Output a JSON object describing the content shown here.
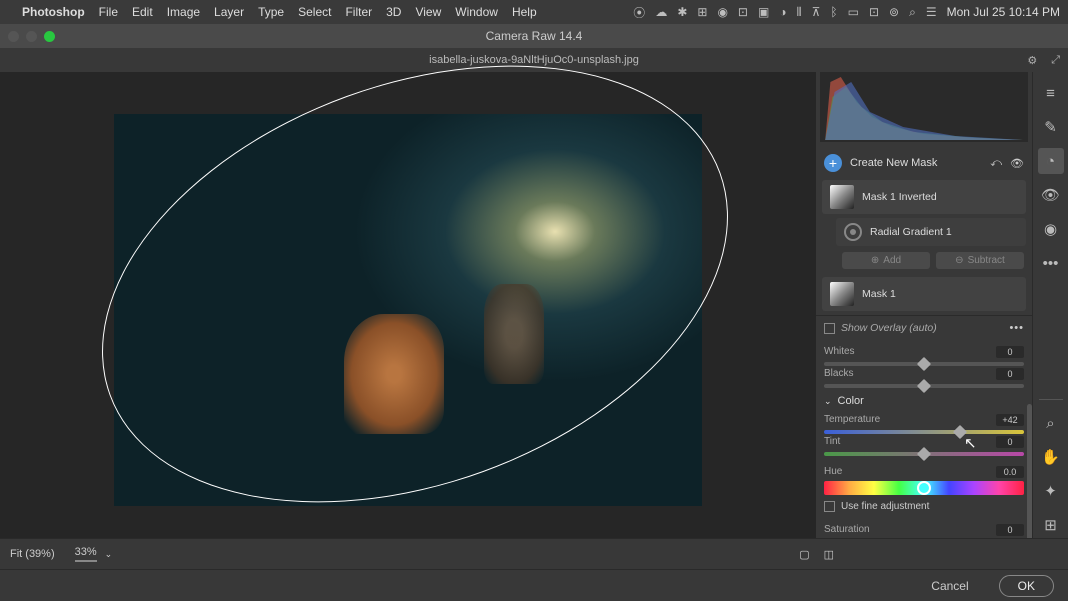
{
  "menubar": {
    "app": "Photoshop",
    "items": [
      "File",
      "Edit",
      "Image",
      "Layer",
      "Type",
      "Select",
      "Filter",
      "3D",
      "View",
      "Window",
      "Help"
    ],
    "datetime": "Mon Jul 25  10:14 PM"
  },
  "window": {
    "title": "Camera Raw 14.4",
    "filename": "isabella-juskova-9aNltHjuOc0-unsplash.jpg"
  },
  "masking": {
    "create_label": "Create New Mask",
    "mask1_inverted": "Mask 1 Inverted",
    "radial_gradient": "Radial Gradient 1",
    "add": "Add",
    "subtract": "Subtract",
    "mask1": "Mask 1",
    "overlay_label": "Show Overlay (auto)"
  },
  "adjustments": {
    "whites": {
      "label": "Whites",
      "value": "0"
    },
    "blacks": {
      "label": "Blacks",
      "value": "0"
    },
    "color_section": "Color",
    "temperature": {
      "label": "Temperature",
      "value": "+42"
    },
    "tint": {
      "label": "Tint",
      "value": "0"
    },
    "hue": {
      "label": "Hue",
      "value": "0.0"
    },
    "fine_adj": "Use fine adjustment",
    "saturation": {
      "label": "Saturation",
      "value": "0"
    }
  },
  "bottom": {
    "fit": "Fit (39%)",
    "zoom": "33%"
  },
  "footer": {
    "cancel": "Cancel",
    "ok": "OK"
  }
}
